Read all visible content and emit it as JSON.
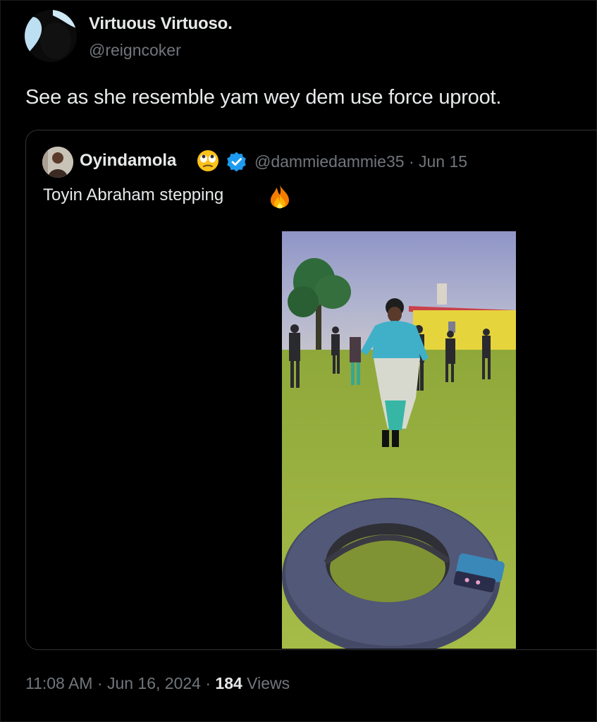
{
  "author": {
    "display_name": "Virtuous Virtuoso.",
    "handle": "@reigncoker"
  },
  "tweet": {
    "text": "See as she resemble yam wey dem use force uproot."
  },
  "quoted": {
    "display_name": "Oyindamola",
    "name_emoji": "rolling-eyes-emoji",
    "verified": true,
    "handle": "@dammiedammie35",
    "separator": "·",
    "date": "Jun 15",
    "text": "Toyin Abraham stepping",
    "text_emoji": "fire-emoji",
    "media": "video thumbnail: woman in teal top dancing on grass field with people and yellow building in background, tire in foreground"
  },
  "footer": {
    "time": "11:08 AM",
    "separator1": "·",
    "date": "Jun 16, 2024",
    "separator2": "·",
    "views_count": "184",
    "views_label": "Views"
  },
  "colors": {
    "background": "#000000",
    "primary_text": "#e7e9ea",
    "secondary_text": "#71767b",
    "border": "#2f3336",
    "verified_blue": "#1d9bf0"
  }
}
